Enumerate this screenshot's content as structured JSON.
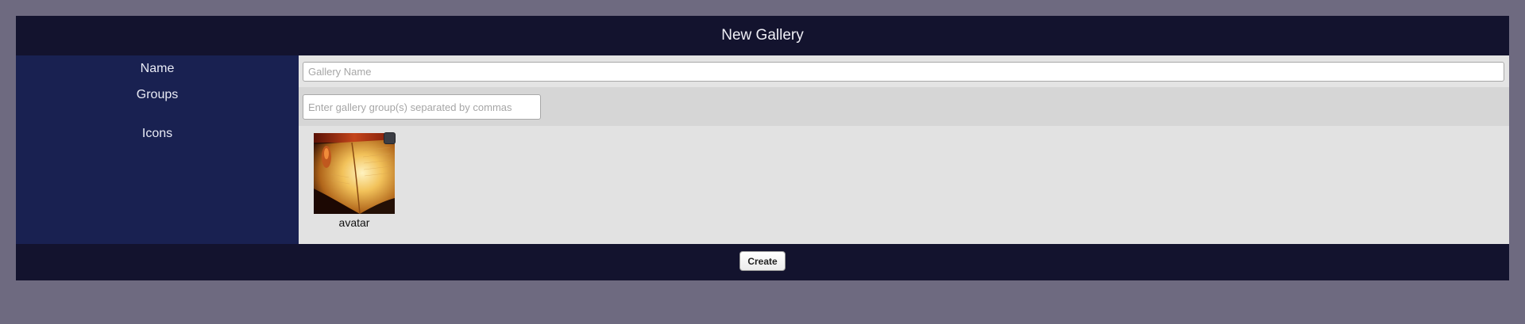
{
  "dialog": {
    "title": "New Gallery"
  },
  "form": {
    "name_label": "Name",
    "name_placeholder": "Gallery Name",
    "name_value": "",
    "groups_label": "Groups",
    "groups_placeholder": "Enter gallery group(s) separated by commas",
    "groups_value": "",
    "icons_label": "Icons",
    "icons": [
      {
        "caption": "avatar",
        "image": "open-book-photo",
        "selected": false
      }
    ]
  },
  "footer": {
    "create_label": "Create"
  },
  "colors": {
    "page_background": "#6e6a80",
    "header_background": "#13132e",
    "label_column_background": "#192151",
    "content_background": "#e2e2e2"
  }
}
